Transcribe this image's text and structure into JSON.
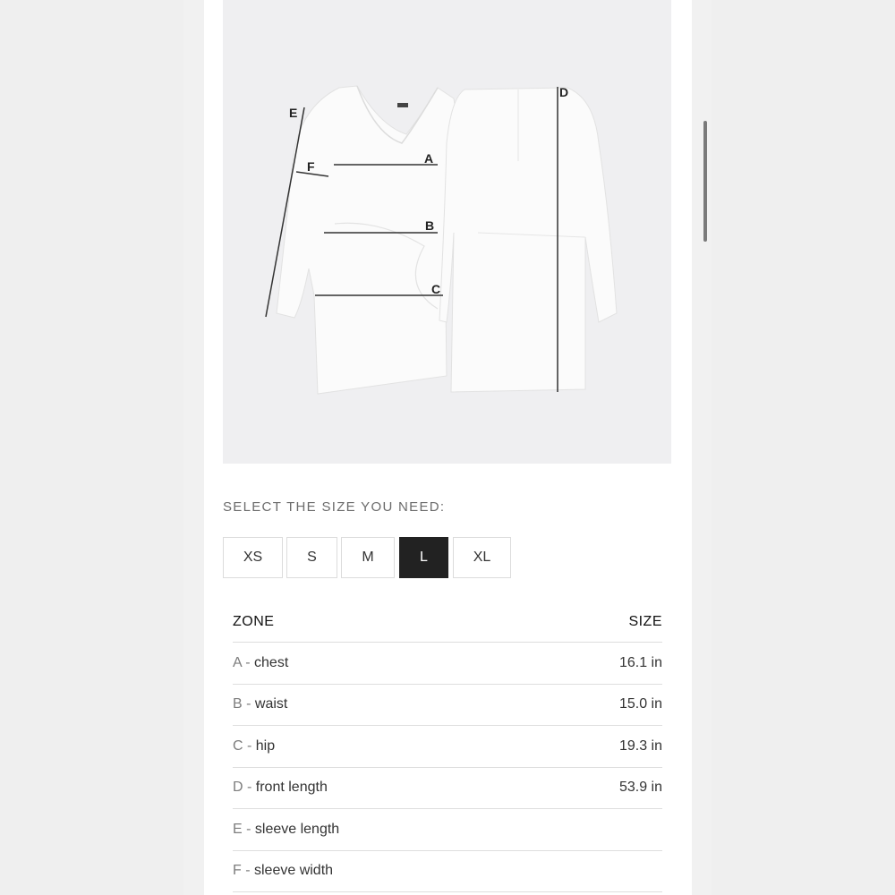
{
  "image": {
    "labels": [
      "A",
      "B",
      "C",
      "D",
      "E",
      "F"
    ]
  },
  "size_prompt": "SELECT THE SIZE YOU NEED:",
  "sizes": [
    "XS",
    "S",
    "M",
    "L",
    "XL"
  ],
  "selected_size": "L",
  "table": {
    "headers": {
      "zone": "ZONE",
      "size": "SIZE"
    },
    "rows": [
      {
        "letter": "A",
        "sep": " - ",
        "zone": "chest",
        "size": "16.1 in"
      },
      {
        "letter": "B",
        "sep": " - ",
        "zone": "waist",
        "size": "15.0 in"
      },
      {
        "letter": "C",
        "sep": " - ",
        "zone": "hip",
        "size": "19.3 in"
      },
      {
        "letter": "D",
        "sep": " - ",
        "zone": "front length",
        "size": "53.9 in"
      },
      {
        "letter": "E",
        "sep": " - ",
        "zone": "sleeve length",
        "size": ""
      },
      {
        "letter": "F",
        "sep": " - ",
        "zone": "sleeve width",
        "size": ""
      }
    ]
  },
  "colors": {
    "selected_bg": "#222222",
    "image_bg": "#efeff1"
  }
}
